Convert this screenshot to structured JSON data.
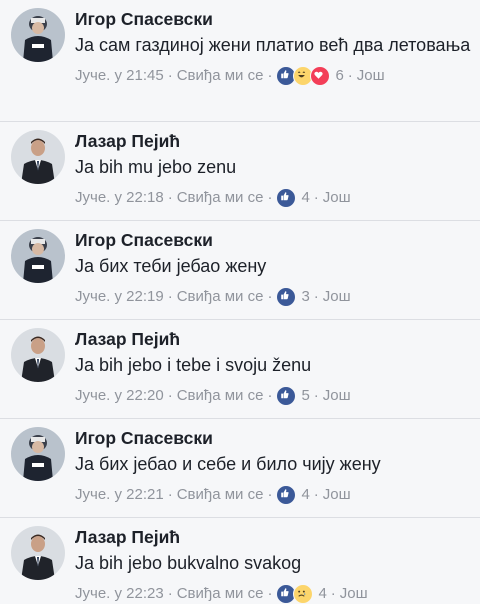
{
  "comments": [
    {
      "author": "Игор Спасевски",
      "text": "Ја сам газдиној жени платио већ два летовања",
      "time": "Јуче. у 21:45",
      "like_label": "Свиђа ми се",
      "reactions": [
        "like-icon",
        "haha-icon",
        "love-icon"
      ],
      "count": "6",
      "more_label": "Још"
    },
    {
      "author": "Лазар Пејић",
      "text": "Ja bih mu jebo zenu",
      "time": "Јуче. у 22:18",
      "like_label": "Свиђа ми се",
      "reactions": [
        "like-icon"
      ],
      "count": "4",
      "more_label": "Још"
    },
    {
      "author": "Игор Спасевски",
      "text": "Ја бих теби јебао жену",
      "time": "Јуче. у 22:19",
      "like_label": "Свиђа ми се",
      "reactions": [
        "like-icon"
      ],
      "count": "3",
      "more_label": "Још"
    },
    {
      "author": "Лазар Пејић",
      "text": "Ja bih jebo i tebe i svoju ženu",
      "time": "Јуче. у 22:20",
      "like_label": "Свиђа ми се",
      "reactions": [
        "like-icon"
      ],
      "count": "5",
      "more_label": "Још"
    },
    {
      "author": "Игор Спасевски",
      "text": "Ја бих јебао и себе и било чију жену",
      "time": "Јуче. у 22:21",
      "like_label": "Свиђа ми се",
      "reactions": [
        "like-icon"
      ],
      "count": "4",
      "more_label": "Још"
    },
    {
      "author": "Лазар Пејић",
      "text": "Ja bih jebo bukvalno svakog",
      "time": "Јуче. у 22:23",
      "like_label": "Свиђа ми се",
      "reactions": [
        "like-icon",
        "sad-icon"
      ],
      "count": "4",
      "more_label": "Још"
    }
  ],
  "colors": {
    "like": "#3b5998",
    "love": "#f33e58",
    "reaction_yellow": "#fcd56b",
    "meta_text": "#90949c",
    "separator": "#dcdee3",
    "background": "#f6f7f9"
  }
}
